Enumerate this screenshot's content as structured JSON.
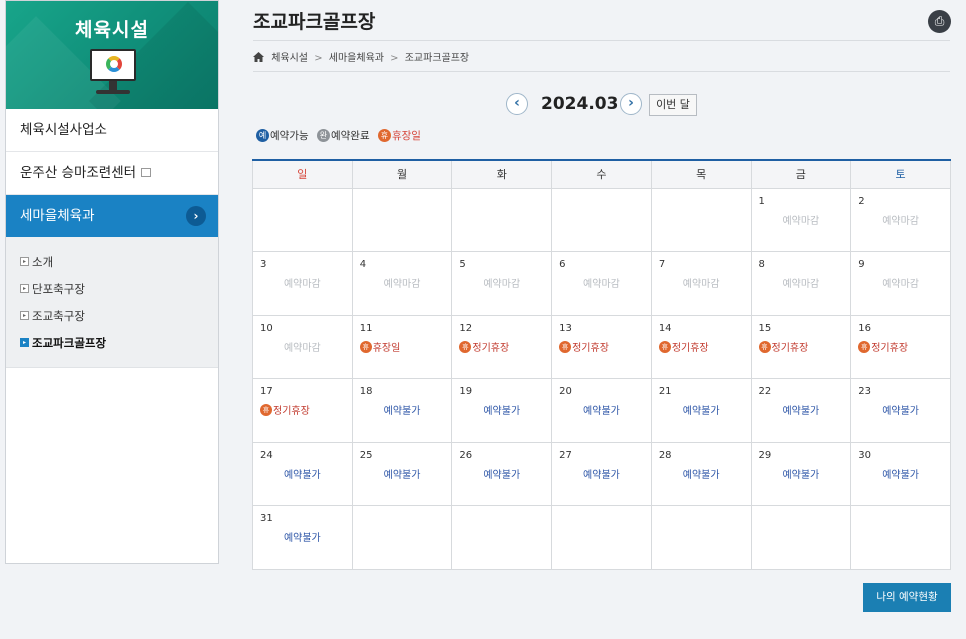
{
  "sidebar": {
    "title": "체육시설",
    "items": [
      {
        "label": "체육시설사업소"
      },
      {
        "label": "운주산 승마조련센터"
      }
    ],
    "active": {
      "label": "세마을체육과"
    },
    "sub_items": [
      {
        "label": "소개",
        "mark": "▸"
      },
      {
        "label": "단포축구장",
        "mark": "▸"
      },
      {
        "label": "조교축구장",
        "mark": "▸"
      },
      {
        "label": "조교파크골프장",
        "mark": "▸"
      }
    ]
  },
  "page": {
    "title": "조교파크골프장",
    "print_icon": "printer-icon"
  },
  "breadcrumb": {
    "items": [
      "체육시설",
      "세마을체육과",
      "조교파크골프장"
    ],
    "sep": ">"
  },
  "calendar_nav": {
    "prev": "‹",
    "next": "›",
    "month": "2024.03",
    "this_month": "이번 달"
  },
  "legend": {
    "available_badge": "예",
    "available": "예약가능",
    "done_badge": "완",
    "done": "예약완료",
    "closed_badge": "휴",
    "closed": "휴장일"
  },
  "weekdays": [
    "일",
    "월",
    "화",
    "수",
    "목",
    "금",
    "토"
  ],
  "weeks": [
    [
      {
        "d": "",
        "s": ""
      },
      {
        "d": "",
        "s": ""
      },
      {
        "d": "",
        "s": ""
      },
      {
        "d": "",
        "s": ""
      },
      {
        "d": "",
        "s": ""
      },
      {
        "d": "1",
        "s": "예약마감",
        "t": "deadline"
      },
      {
        "d": "2",
        "s": "예약마감",
        "t": "deadline"
      }
    ],
    [
      {
        "d": "3",
        "s": "예약마감",
        "t": "deadline"
      },
      {
        "d": "4",
        "s": "예약마감",
        "t": "deadline"
      },
      {
        "d": "5",
        "s": "예약마감",
        "t": "deadline"
      },
      {
        "d": "6",
        "s": "예약마감",
        "t": "deadline"
      },
      {
        "d": "7",
        "s": "예약마감",
        "t": "deadline"
      },
      {
        "d": "8",
        "s": "예약마감",
        "t": "deadline"
      },
      {
        "d": "9",
        "s": "예약마감",
        "t": "deadline"
      }
    ],
    [
      {
        "d": "10",
        "s": "예약마감",
        "t": "deadline"
      },
      {
        "d": "11",
        "s": "휴장일",
        "t": "closed"
      },
      {
        "d": "12",
        "s": "정기휴장",
        "t": "closed"
      },
      {
        "d": "13",
        "s": "정기휴장",
        "t": "closed"
      },
      {
        "d": "14",
        "s": "정기휴장",
        "t": "closed"
      },
      {
        "d": "15",
        "s": "정기휴장",
        "t": "closed"
      },
      {
        "d": "16",
        "s": "정기휴장",
        "t": "closed"
      }
    ],
    [
      {
        "d": "17",
        "s": "정기휴장",
        "t": "closed"
      },
      {
        "d": "18",
        "s": "예약불가",
        "t": "unavail"
      },
      {
        "d": "19",
        "s": "예약불가",
        "t": "unavail"
      },
      {
        "d": "20",
        "s": "예약불가",
        "t": "unavail"
      },
      {
        "d": "21",
        "s": "예약불가",
        "t": "unavail"
      },
      {
        "d": "22",
        "s": "예약불가",
        "t": "unavail"
      },
      {
        "d": "23",
        "s": "예약불가",
        "t": "unavail"
      }
    ],
    [
      {
        "d": "24",
        "s": "예약불가",
        "t": "unavail"
      },
      {
        "d": "25",
        "s": "예약불가",
        "t": "unavail"
      },
      {
        "d": "26",
        "s": "예약불가",
        "t": "unavail"
      },
      {
        "d": "27",
        "s": "예약불가",
        "t": "unavail"
      },
      {
        "d": "28",
        "s": "예약불가",
        "t": "unavail"
      },
      {
        "d": "29",
        "s": "예약불가",
        "t": "unavail"
      },
      {
        "d": "30",
        "s": "예약불가",
        "t": "unavail"
      }
    ],
    [
      {
        "d": "31",
        "s": "예약불가",
        "t": "unavail"
      },
      {
        "d": "",
        "s": ""
      },
      {
        "d": "",
        "s": ""
      },
      {
        "d": "",
        "s": ""
      },
      {
        "d": "",
        "s": ""
      },
      {
        "d": "",
        "s": ""
      },
      {
        "d": "",
        "s": ""
      }
    ]
  ],
  "closed_badge": "휴",
  "my_reservations": "나의 예약현황",
  "colors": {
    "accent": "#1a82c4",
    "closed": "#e0682f",
    "unavailable": "#2f57a8"
  }
}
